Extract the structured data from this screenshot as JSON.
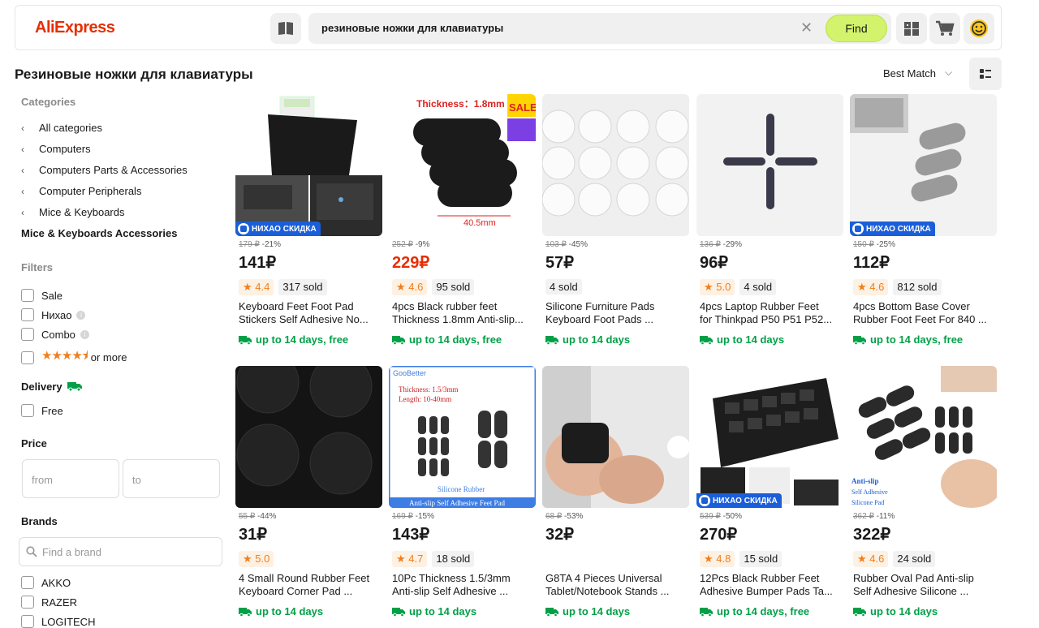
{
  "header": {
    "logo": "AliExpress",
    "search_query": "резиновые ножки для клавиатуры",
    "clear_icon": "close-icon",
    "find_label": "Find",
    "icons": [
      "catalog-icon",
      "compare-icon",
      "cart-icon",
      "account-icon"
    ]
  },
  "title_row": {
    "page_title": "Резиновые ножки для клавиатуры",
    "sort_label": "Best Match"
  },
  "sidebar": {
    "categories_heading": "Categories",
    "categories": [
      "All categories",
      "Computers",
      "Computers Parts & Accessories",
      "Computer Peripherals",
      "Mice & Keyboards"
    ],
    "current_category": "Mice & Keyboards Accessories",
    "filters_heading": "Filters",
    "filters": {
      "sale": "Sale",
      "nihao": "Нихао",
      "combo": "Combo",
      "rating_suffix": "or more",
      "rating_stars": 4.5
    },
    "delivery_heading": "Delivery",
    "delivery_free": "Free",
    "price_heading": "Price",
    "price_from_placeholder": "from",
    "price_to_placeholder": "to",
    "brands_heading": "Brands",
    "brand_search_placeholder": "Find a brand",
    "brands": [
      "AKKO",
      "RAZER",
      "LOGITECH"
    ]
  },
  "badge_text": "НИХАО СКИДКА",
  "products": [
    {
      "old_price": "179 ₽",
      "discount": "-21%",
      "price": "141₽",
      "red": false,
      "rating": "4.4",
      "sold": "317 sold",
      "title1": "Keyboard Feet Foot Pad",
      "title2": "Stickers Self Adhesive No...",
      "delivery": "up to 14 days, free",
      "badge": true
    },
    {
      "old_price": "252 ₽",
      "discount": "-9%",
      "price": "229₽",
      "red": true,
      "rating": "4.6",
      "sold": "95 sold",
      "title1": "4pcs Black rubber feet",
      "title2": "Thickness 1.8mm Anti-slip...",
      "delivery": "up to 14 days, free",
      "badge": false
    },
    {
      "old_price": "103 ₽",
      "discount": "-45%",
      "price": "57₽",
      "red": false,
      "rating": "",
      "sold": "4 sold",
      "title1": "Silicone Furniture Pads",
      "title2": "Keyboard Foot Pads ...",
      "delivery": "up to 14 days",
      "badge": false
    },
    {
      "old_price": "136 ₽",
      "discount": "-29%",
      "price": "96₽",
      "red": false,
      "rating": "5.0",
      "sold": "4 sold",
      "title1": "4pcs Laptop Rubber Feet",
      "title2": "for Thinkpad P50 P51 P52...",
      "delivery": "up to 14 days",
      "badge": false
    },
    {
      "old_price": "150 ₽",
      "discount": "-25%",
      "price": "112₽",
      "red": false,
      "rating": "4.6",
      "sold": "812 sold",
      "title1": "4pcs Bottom Base Cover",
      "title2": "Rubber Foot Feet For 840 ...",
      "delivery": "up to 14 days, free",
      "badge": true
    },
    {
      "old_price": "55 ₽",
      "discount": "-44%",
      "price": "31₽",
      "red": false,
      "rating": "5.0",
      "sold": "",
      "title1": "4 Small Round Rubber Feet",
      "title2": "Keyboard Corner Pad ...",
      "delivery": "up to 14 days",
      "badge": false
    },
    {
      "old_price": "169 ₽",
      "discount": "-15%",
      "price": "143₽",
      "red": false,
      "rating": "4.7",
      "sold": "18 sold",
      "title1": "10Pc Thickness 1.5/3mm",
      "title2": "Anti-slip Self Adhesive ...",
      "delivery": "up to 14 days",
      "badge": false
    },
    {
      "old_price": "68 ₽",
      "discount": "-53%",
      "price": "32₽",
      "red": false,
      "rating": "",
      "sold": "",
      "title1": "G8TA 4 Pieces Universal",
      "title2": "Tablet/Notebook Stands ...",
      "delivery": "up to 14 days",
      "badge": false
    },
    {
      "old_price": "539 ₽",
      "discount": "-50%",
      "price": "270₽",
      "red": false,
      "rating": "4.8",
      "sold": "15 sold",
      "title1": "12Pcs Black Rubber Feet",
      "title2": "Adhesive Bumper Pads Ta...",
      "delivery": "up to 14 days, free",
      "badge": true
    },
    {
      "old_price": "362 ₽",
      "discount": "-11%",
      "price": "322₽",
      "red": false,
      "rating": "4.6",
      "sold": "24 sold",
      "title1": "Rubber Oval Pad Anti-slip",
      "title2": "Self Adhesive Silicone ...",
      "delivery": "up to 14 days",
      "badge": false
    }
  ],
  "image_texts": {
    "p2_thickness": "Thickness：1.8mm",
    "p2_dim": "40.5mm",
    "p2_sale": "SALE",
    "p7_brand": "GooBetter",
    "p7_thickness": "Thickness: 1.5/3mm",
    "p7_length": "Length: 10-40mm",
    "p7_material": "Silicone Rubber",
    "p7_caption": "Anti-slip Self Adhesive Feet Pad",
    "p10_line1": "Anti-slip",
    "p10_line2": "Self Adhesive",
    "p10_line3": "Silicone Pad"
  },
  "colors": {
    "brand": "#e62e04",
    "find_button": "#d3f36c",
    "delivery_green": "#00a047",
    "rating_orange": "#f27e1b",
    "badge_blue": "#1a5fd9"
  }
}
